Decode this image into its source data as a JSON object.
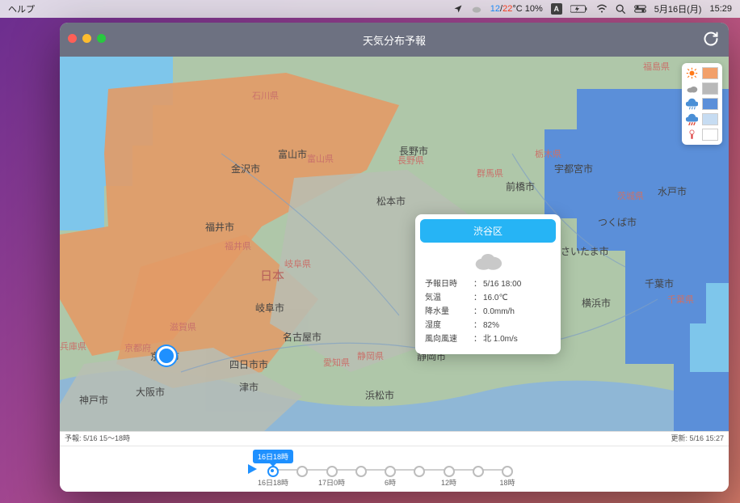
{
  "menubar": {
    "help": "ヘルプ",
    "temp_lo": "12",
    "temp_sep": "/",
    "temp_hi": "22",
    "temp_unit": "°C",
    "chance": "10%",
    "input_badge": "A",
    "date": "5月16日(月)",
    "time": "15:29"
  },
  "window": {
    "title": "天気分布予報",
    "traffic": {
      "close": "#ff5f57",
      "min": "#febc2e",
      "max": "#28c840"
    }
  },
  "legend": {
    "items": [
      {
        "name": "sunny",
        "color": "#f2a06a"
      },
      {
        "name": "cloudy",
        "color": "#b9b9b9"
      },
      {
        "name": "rain",
        "color": "#5b8fd9"
      },
      {
        "name": "heavy-rain",
        "color": "#c6dcf2"
      },
      {
        "name": "snow",
        "color": "#ffffff"
      }
    ]
  },
  "map": {
    "country": "日本",
    "prefs": [
      "福島県",
      "石川県",
      "富山県",
      "長野県",
      "群馬県",
      "栃木県",
      "茨城県",
      "福井県",
      "岐阜県",
      "愛知県",
      "滋賀県",
      "京都府",
      "兵庫県",
      "静岡県",
      "千葉県"
    ],
    "cities": [
      "金沢市",
      "富山市",
      "長野市",
      "前橋市",
      "宇都宮市",
      "水戸市",
      "つくば市",
      "さいたま市",
      "千葉市",
      "横浜市",
      "名古屋市",
      "岐阜市",
      "福井市",
      "京都市",
      "大阪市",
      "神戸市",
      "四日市市",
      "津市",
      "松本市",
      "浜松市",
      "静岡市"
    ]
  },
  "popup": {
    "place": "渋谷区",
    "rows": [
      {
        "k": "予報日時",
        "v": "5/16 18:00"
      },
      {
        "k": "気温",
        "v": "16.0℃"
      },
      {
        "k": "降水量",
        "v": "0.0mm/h"
      },
      {
        "k": "湿度",
        "v": "82%"
      },
      {
        "k": "風向風速",
        "v": "北 1.0m/s"
      }
    ]
  },
  "status": {
    "left": "予報: 5/16 15～18時",
    "right": "更新: 5/16 15:27"
  },
  "timeline": {
    "bubble": "16日18時",
    "labels": [
      "16日18時",
      "17日0時",
      "6時",
      "12時",
      "18時"
    ],
    "active_index": 0,
    "tick_count": 9
  }
}
